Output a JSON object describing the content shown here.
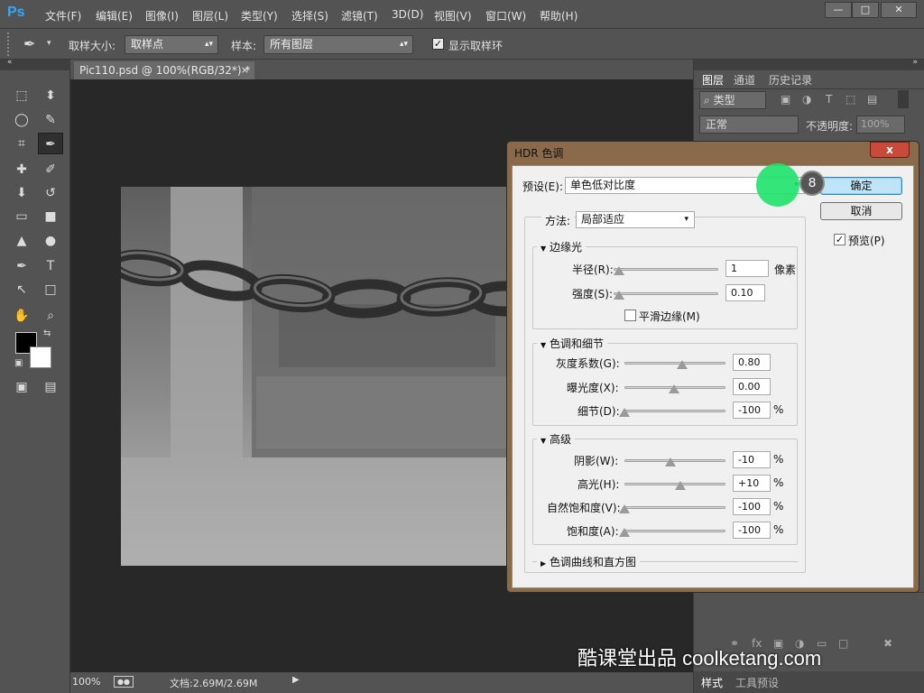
{
  "app": {
    "logo": "Ps",
    "menus": [
      "文件(F)",
      "编辑(E)",
      "图像(I)",
      "图层(L)",
      "类型(Y)",
      "选择(S)",
      "滤镜(T)",
      "3D(D)",
      "视图(V)",
      "窗口(W)",
      "帮助(H)"
    ]
  },
  "options": {
    "sample_size_label": "取样大小:",
    "sample_size_value": "取样点",
    "sample_label": "样本:",
    "sample_value": "所有图层",
    "show_ring_label": "显示取样环"
  },
  "document": {
    "tab_title": "Pic110.psd @ 100%(RGB/32*) *",
    "zoom": "100%",
    "doc_size": "文档:2.69M/2.69M"
  },
  "panels": {
    "tabs": [
      "图层",
      "通道",
      "历史记录"
    ],
    "filter_kind": "类型",
    "blend_mode": "正常",
    "opacity_label": "不透明度:",
    "opacity_value": "100%",
    "bottom_tabs": [
      "样式",
      "工具预设"
    ]
  },
  "dialog": {
    "title": "HDR 色调",
    "close": "x",
    "preset_label": "预设(E):",
    "preset_value": "单色低对比度",
    "ok": "确定",
    "cancel": "取消",
    "preview_label": "预览(P)",
    "method_label": "方法:",
    "method_value": "局部适应",
    "edge_glow": {
      "title": "边缘光",
      "radius_label": "半径(R):",
      "radius_value": "1",
      "radius_unit": "像素",
      "strength_label": "强度(S):",
      "strength_value": "0.10",
      "smooth_label": "平滑边缘(M)"
    },
    "tone_detail": {
      "title": "色调和细节",
      "gamma_label": "灰度系数(G):",
      "gamma_value": "0.80",
      "exposure_label": "曝光度(X):",
      "exposure_value": "0.00",
      "detail_label": "细节(D):",
      "detail_value": "-100",
      "detail_unit": "%"
    },
    "advanced": {
      "title": "高级",
      "shadow_label": "阴影(W):",
      "shadow_value": "-10",
      "highlight_label": "高光(H):",
      "highlight_value": "+10",
      "vibrance_label": "自然饱和度(V):",
      "vibrance_value": "-100",
      "saturation_label": "饱和度(A):",
      "saturation_value": "-100",
      "unit": "%"
    },
    "curve_section": "色调曲线和直方图"
  },
  "overlay": {
    "step_number": "8",
    "watermark": "酷课堂出品 coolketang.com"
  }
}
